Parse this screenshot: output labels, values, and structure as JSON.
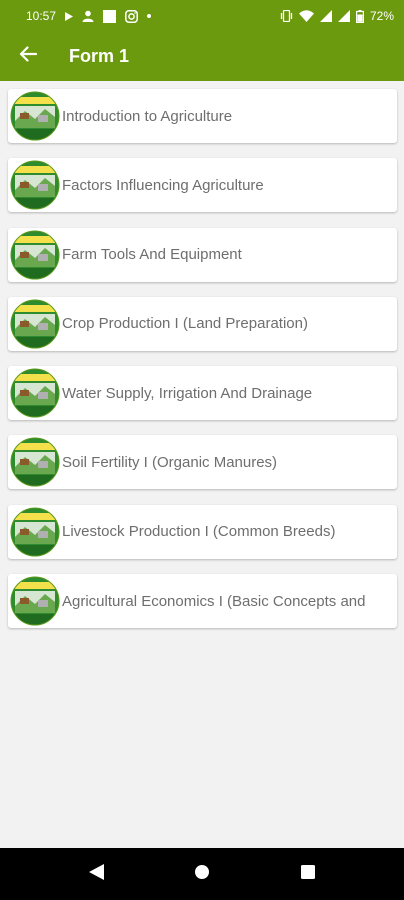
{
  "status_bar": {
    "time": "10:57",
    "battery": "72%",
    "left_icons": [
      "play-icon",
      "person-icon",
      "square-icon",
      "instagram-icon",
      "dot-icon"
    ],
    "right_icons": [
      "vibrate-icon",
      "wifi-icon",
      "signal-icon",
      "signal-icon",
      "battery-icon"
    ]
  },
  "app_bar": {
    "title": "Form 1",
    "back_icon": "arrow-left-icon",
    "color": "#6b9a0e"
  },
  "topics": [
    {
      "label": "Introduction to Agriculture"
    },
    {
      "label": "Factors Influencing Agriculture"
    },
    {
      "label": "Farm Tools And Equipment"
    },
    {
      "label": "Crop Production I (Land Preparation)"
    },
    {
      "label": "Water Supply, Irrigation And Drainage"
    },
    {
      "label": "Soil Fertility I (Organic Manures)"
    },
    {
      "label": "Livestock Production I (Common Breeds)"
    },
    {
      "label": "Agricultural Economics I (Basic Concepts and"
    }
  ],
  "nav_bar": {
    "back_icon": "triangle-back-icon",
    "home_icon": "circle-home-icon",
    "recents_icon": "square-recents-icon"
  }
}
